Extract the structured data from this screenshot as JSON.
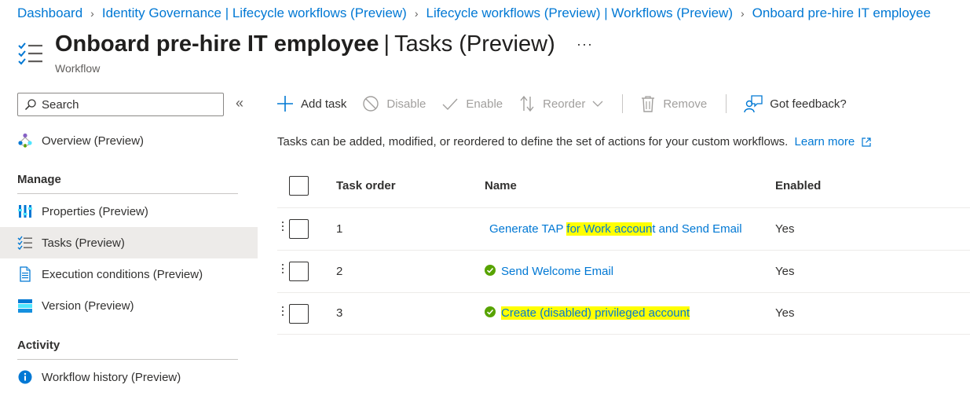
{
  "breadcrumb": [
    "Dashboard",
    "Identity Governance | Lifecycle workflows (Preview)",
    "Lifecycle workflows (Preview) | Workflows (Preview)",
    "Onboard pre-hire IT employee"
  ],
  "header": {
    "title_main": "Onboard pre-hire IT employee",
    "title_sep": "|",
    "title_section": "Tasks (Preview)",
    "subtitle": "Workflow",
    "more": "···"
  },
  "sidebar": {
    "search_placeholder": "Search",
    "collapse": "«",
    "overview": "Overview (Preview)",
    "manage_label": "Manage",
    "manage_items": [
      "Properties (Preview)",
      "Tasks (Preview)",
      "Execution conditions (Preview)",
      "Version (Preview)"
    ],
    "activity_label": "Activity",
    "activity_items": [
      "Workflow history (Preview)"
    ],
    "active_item": "Tasks (Preview)"
  },
  "toolbar": {
    "add_task": "Add task",
    "disable": "Disable",
    "enable": "Enable",
    "reorder": "Reorder",
    "remove": "Remove",
    "feedback": "Got feedback?"
  },
  "description": {
    "text": "Tasks can be added, modified, or reordered to define the set of actions for your custom workflows.",
    "link": "Learn more"
  },
  "table": {
    "headers": {
      "order": "Task order",
      "name": "Name",
      "enabled": "Enabled"
    },
    "rows": [
      {
        "order": "1",
        "name_a": "Generate TAP ",
        "name_hl": "for Work accoun",
        "name_b": "t and Send Email",
        "enabled": "Yes",
        "status": "none"
      },
      {
        "order": "2",
        "name_a": "Send Welcome Email",
        "name_hl": "",
        "name_b": "",
        "enabled": "Yes",
        "status": "success"
      },
      {
        "order": "3",
        "name_a": "",
        "name_hl": "Create (disabled) privileged account",
        "name_b": "",
        "enabled": "Yes",
        "status": "success"
      }
    ]
  },
  "colors": {
    "link": "#0078d4",
    "highlight": "#ffff00",
    "success": "#57a300",
    "active_nav": "#edebe9"
  }
}
